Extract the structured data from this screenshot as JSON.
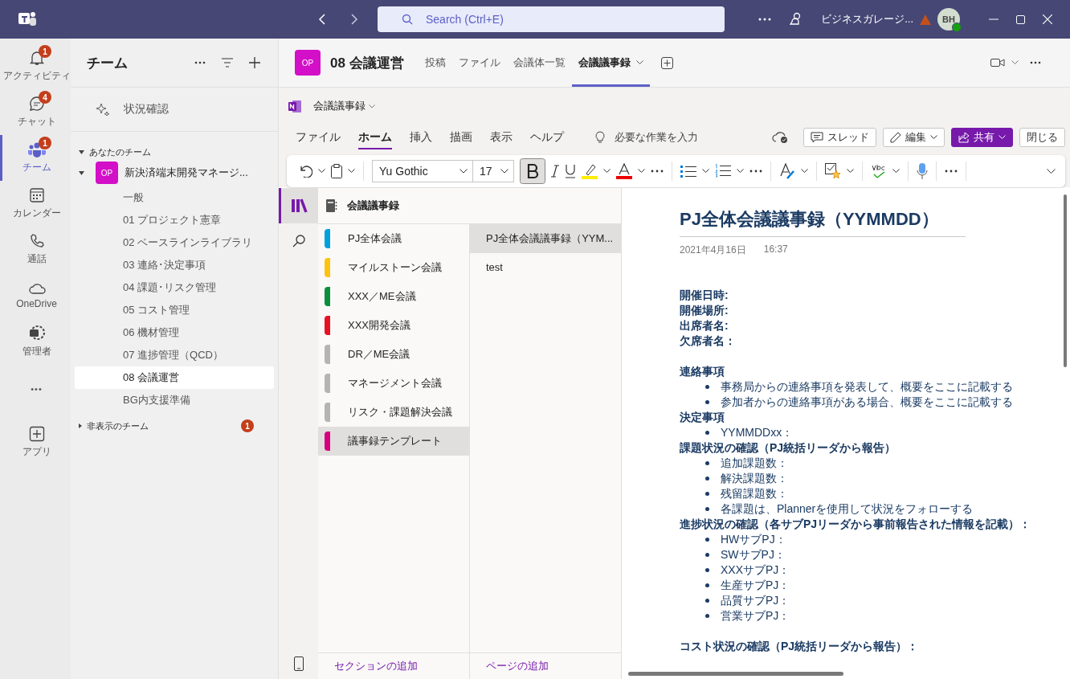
{
  "titlebar": {
    "search_placeholder": "Search (Ctrl+E)",
    "org": "ビジネスガレージ...",
    "avatar": "BH"
  },
  "rail": [
    {
      "kind": "bell",
      "label": "アクティビティ",
      "badge": "1",
      "selected": false
    },
    {
      "kind": "chat",
      "label": "チャット",
      "badge": "4",
      "selected": false
    },
    {
      "kind": "teams",
      "label": "チーム",
      "badge": "1",
      "selected": true
    },
    {
      "kind": "calendar",
      "label": "カレンダー",
      "selected": false
    },
    {
      "kind": "phone",
      "label": "通話",
      "selected": false
    },
    {
      "kind": "cloud",
      "label": "OneDrive",
      "selected": false
    },
    {
      "kind": "admin",
      "label": "管理者",
      "selected": false
    },
    {
      "kind": "more",
      "label": "•••",
      "selected": false
    },
    {
      "kind": "apps",
      "label": "アプリ",
      "selected": false
    }
  ],
  "teams_panel": {
    "title": "チーム",
    "status": "状況確認",
    "section": "あなたのチーム",
    "team": {
      "avatar": "OP",
      "name": "新決済端末開発マネージ...",
      "channels": [
        {
          "name": "一般",
          "selected": false
        },
        {
          "name": "01 プロジェクト憲章",
          "selected": false
        },
        {
          "name": "02 ベースラインライブラリ",
          "selected": false
        },
        {
          "name": "03 連絡･決定事項",
          "selected": false
        },
        {
          "name": "04 課題･リスク管理",
          "selected": false
        },
        {
          "name": "05 コスト管理",
          "selected": false
        },
        {
          "name": "06 機材管理",
          "selected": false
        },
        {
          "name": "07 進捗管理（QCD）",
          "selected": false
        },
        {
          "name": "08 会議運営",
          "selected": true
        },
        {
          "name": "BG内支援準備",
          "selected": false
        }
      ]
    },
    "hidden": {
      "label": "非表示のチーム",
      "badge": "1"
    }
  },
  "channel": {
    "avatar": "OP",
    "title": "08 会議運営",
    "tabs": [
      {
        "label": "投稿",
        "selected": false
      },
      {
        "label": "ファイル",
        "selected": false
      },
      {
        "label": "会議体一覧",
        "selected": false
      },
      {
        "label": "会議議事録",
        "selected": true
      }
    ]
  },
  "onenote": {
    "notebook": "会議議事録",
    "ribbon_tabs": [
      {
        "label": "ファイル",
        "selected": false
      },
      {
        "label": "ホーム",
        "selected": true
      },
      {
        "label": "挿入",
        "selected": false
      },
      {
        "label": "描画",
        "selected": false
      },
      {
        "label": "表示",
        "selected": false
      },
      {
        "label": "ヘルプ",
        "selected": false
      }
    ],
    "tell_me": "必要な作業を入力",
    "thread": "スレッド",
    "edit": "編集",
    "share": "共有",
    "close": "閉じる",
    "font": "Yu Gothic",
    "size": "17",
    "bold_on": true,
    "nav_title": "会議議事録",
    "sections": [
      {
        "name": "PJ全体会議",
        "color": "#00a0de",
        "selected": false
      },
      {
        "name": "マイルストーン会議",
        "color": "#ffc20e",
        "selected": false
      },
      {
        "name": "XXX／ME会議",
        "color": "#0a8f3c",
        "selected": false
      },
      {
        "name": "XXX開発会議",
        "color": "#e81123",
        "selected": false
      },
      {
        "name": "DR／ME会議",
        "color": "#b4b4b4",
        "selected": false
      },
      {
        "name": "マネージメント会議",
        "color": "#b4b4b4",
        "selected": false
      },
      {
        "name": "リスク・課題解決会議",
        "color": "#b4b4b4",
        "selected": false
      },
      {
        "name": "議事録テンプレート",
        "color": "#d4007f",
        "selected": true
      }
    ],
    "pages": [
      {
        "title": "PJ全体会議議事録（YYM...",
        "selected": true
      },
      {
        "title": "test",
        "selected": false
      }
    ],
    "add_section": "セクションの追加",
    "add_page": "ページの追加",
    "page": {
      "title": "PJ全体会議議事録（YYMMDD）",
      "date": "2021年4月16日",
      "time": "16:37",
      "blocks": [
        {
          "kind": "blank"
        },
        {
          "kind": "blank"
        },
        {
          "kind": "bold",
          "text": "開催日時:"
        },
        {
          "kind": "bold",
          "text": "開催場所:"
        },
        {
          "kind": "bold",
          "text": "出席者名:"
        },
        {
          "kind": "bold",
          "text": "欠席者名："
        },
        {
          "kind": "blank"
        },
        {
          "kind": "bold",
          "text": "連絡事項"
        },
        {
          "kind": "bullet",
          "text": "事務局からの連絡事項を発表して、概要をここに記載する"
        },
        {
          "kind": "bullet",
          "text": "参加者からの連絡事項がある場合、概要をここに記載する"
        },
        {
          "kind": "bold",
          "text": "決定事項"
        },
        {
          "kind": "bullet",
          "text": "YYMMDDxx："
        },
        {
          "kind": "bold",
          "text": "課題状況の確認（PJ統括リーダから報告）"
        },
        {
          "kind": "bullet",
          "text": "追加課題数："
        },
        {
          "kind": "bullet",
          "text": "解決課題数："
        },
        {
          "kind": "bullet",
          "text": "残留課題数："
        },
        {
          "kind": "bullet",
          "text": "各課題は、Plannerを使用して状況をフォローする"
        },
        {
          "kind": "bold",
          "text": "進捗状況の確認（各サブPJリーダから事前報告された情報を記載）："
        },
        {
          "kind": "bullet",
          "text": "HWサブPJ："
        },
        {
          "kind": "bullet",
          "text": "SWサブPJ："
        },
        {
          "kind": "bullet",
          "text": "XXXサブPJ："
        },
        {
          "kind": "bullet",
          "text": "生産サブPJ："
        },
        {
          "kind": "bullet",
          "text": "品質サブPJ："
        },
        {
          "kind": "bullet",
          "text": "営業サブPJ："
        },
        {
          "kind": "blank"
        },
        {
          "kind": "bold",
          "text": "コスト状況の確認（PJ統括リーダから報告）："
        }
      ]
    }
  }
}
